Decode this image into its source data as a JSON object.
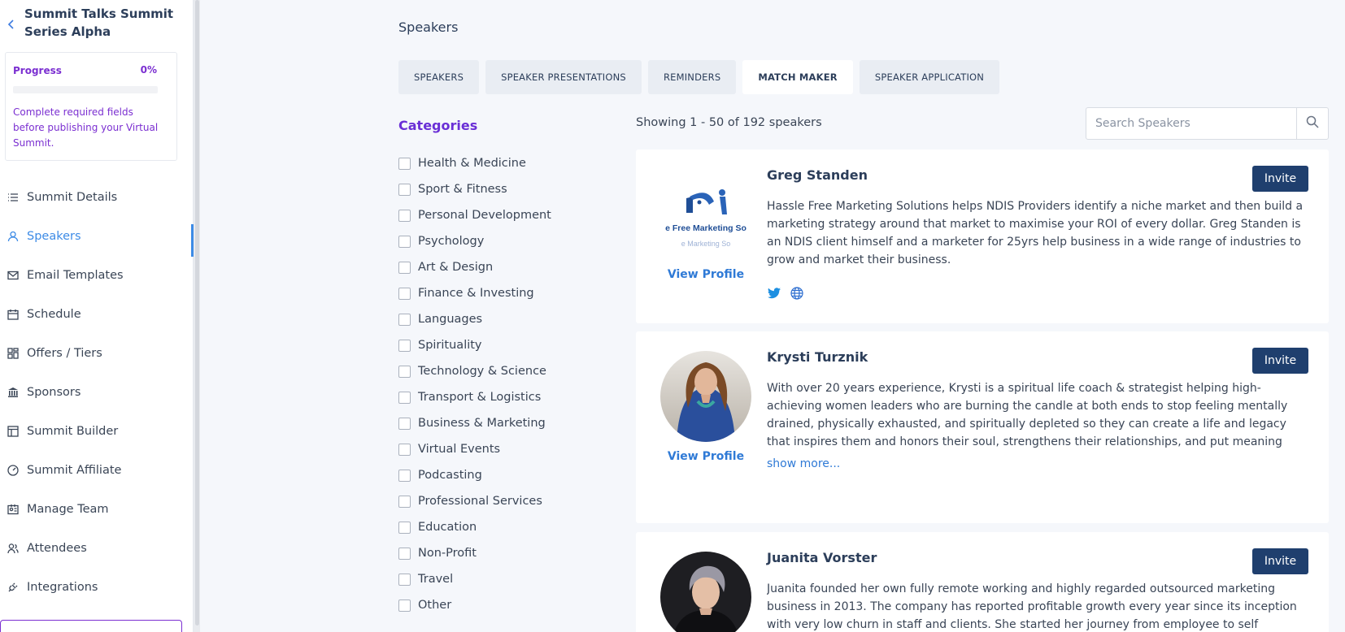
{
  "sidebar": {
    "summit_title": "Summit Talks Summit Series Alpha",
    "progress": {
      "label": "Progress",
      "percent_text": "0%",
      "percent_value": 0,
      "note": "Complete required fields before publishing your Virtual Summit."
    },
    "nav": [
      {
        "label": "Summit Details",
        "icon": "list-icon"
      },
      {
        "label": "Speakers",
        "icon": "user-icon",
        "active": true
      },
      {
        "label": "Email Templates",
        "icon": "mail-icon"
      },
      {
        "label": "Schedule",
        "icon": "calendar-icon"
      },
      {
        "label": "Offers / Tiers",
        "icon": "grid-icon"
      },
      {
        "label": "Sponsors",
        "icon": "bank-icon"
      },
      {
        "label": "Summit Builder",
        "icon": "layout-icon"
      },
      {
        "label": "Summit Affiliate",
        "icon": "gauge-icon"
      },
      {
        "label": "Manage Team",
        "icon": "id-card-icon"
      },
      {
        "label": "Attendees",
        "icon": "users-icon"
      },
      {
        "label": "Integrations",
        "icon": "plug-icon"
      }
    ]
  },
  "main": {
    "page_title": "Speakers",
    "tabs": [
      {
        "label": "SPEAKERS"
      },
      {
        "label": "SPEAKER PRESENTATIONS"
      },
      {
        "label": "REMINDERS"
      },
      {
        "label": "MATCH MAKER",
        "active": true
      },
      {
        "label": "SPEAKER APPLICATION"
      }
    ],
    "categories_title": "Categories",
    "categories": [
      "Health & Medicine",
      "Sport & Fitness",
      "Personal Development",
      "Psychology",
      "Art & Design",
      "Finance & Investing",
      "Languages",
      "Spirituality",
      "Technology & Science",
      "Transport & Logistics",
      "Business & Marketing",
      "Virtual Events",
      "Podcasting",
      "Professional Services",
      "Education",
      "Non-Profit",
      "Travel",
      "Other"
    ],
    "showing_text": "Showing 1 - 50 of 192 speakers",
    "search_placeholder": "Search Speakers",
    "view_profile_label": "View Profile",
    "invite_label": "Invite",
    "show_more_label": "show more...",
    "speakers": [
      {
        "name": "Greg Standen",
        "logo_text": "e Free Marketing So",
        "logo_subtext": "e Marketing So",
        "bio": "Hassle Free Marketing Solutions helps NDIS Providers identify a niche market and then build a marketing strategy around that market to maximise your ROI of every dollar. Greg Standen is an NDIS client himself and a marketer for 25yrs help business in a wide range of industries to grow and market their business."
      },
      {
        "name": "Krysti Turznik",
        "bio": "With over 20 years experience, Krysti is a spiritual life coach & strategist helping high-achieving women leaders who are burning the candle at both ends to stop feeling mentally drained, physically exhausted, and spiritually depleted so they can create a life and legacy that inspires them and honors their soul, strengthens their relationships, and put meaning back in"
      },
      {
        "name": "Juanita Vorster",
        "bio": "Juanita founded her own fully remote working and highly regarded outsourced marketing business in 2013. The company has reported profitable growth every year since its inception with very low churn in staff and clients. She started her journey from employee to self"
      }
    ]
  },
  "colors": {
    "accent_purple": "#7b2fd1",
    "accent_blue": "#3d8be6",
    "invite_navy": "#1f3f6e"
  }
}
